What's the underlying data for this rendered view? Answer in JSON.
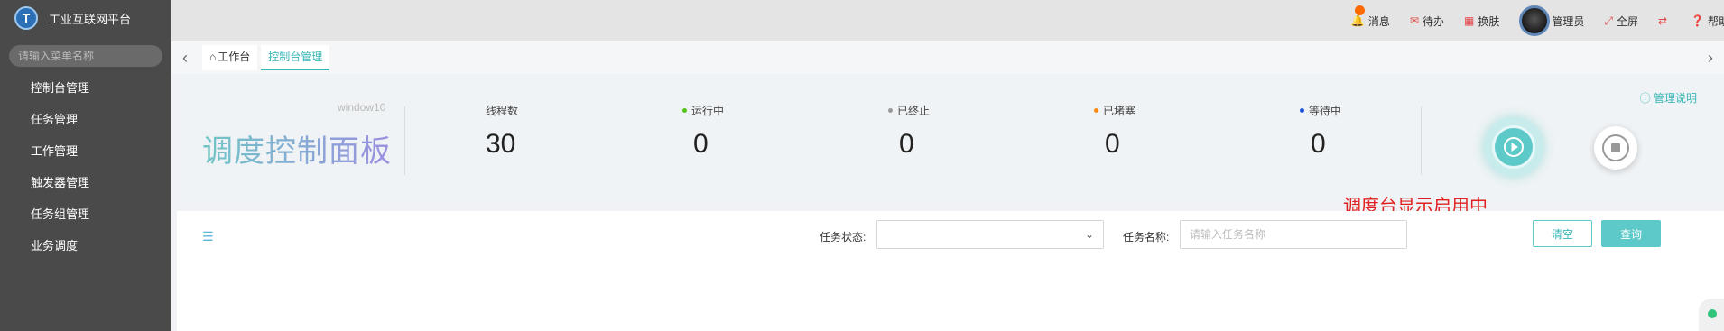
{
  "sidebar": {
    "logo_text": "T",
    "title": "工业互联网平台",
    "search_placeholder": "请输入菜单名称",
    "items": [
      {
        "label": "控制台管理"
      },
      {
        "label": "任务管理"
      },
      {
        "label": "工作管理"
      },
      {
        "label": "触发器管理"
      },
      {
        "label": "任务组管理"
      },
      {
        "label": "业务调度"
      }
    ]
  },
  "topbar": {
    "messages": "消息",
    "todo": "待办",
    "skin": "换肤",
    "user": "管理员",
    "fullscreen": "全屏",
    "help": "帮助"
  },
  "tabs": {
    "home": "工作台",
    "active": "控制台管理"
  },
  "dashboard": {
    "window_label": "window10",
    "title": "调度控制面板",
    "help_link": "管理说明",
    "stats": [
      {
        "label": "线程数",
        "value": "30",
        "color": ""
      },
      {
        "label": "运行中",
        "value": "0",
        "color": "#52c41a"
      },
      {
        "label": "已终止",
        "value": "0",
        "color": "#999999"
      },
      {
        "label": "已堵塞",
        "value": "0",
        "color": "#fa8c16"
      },
      {
        "label": "等待中",
        "value": "0",
        "color": "#1a56db"
      }
    ],
    "annotation": "调度台显示启用中"
  },
  "filters": {
    "status_label": "任务状态:",
    "name_label": "任务名称:",
    "name_placeholder": "请输入任务名称",
    "clear_label": "清空",
    "query_label": "查询"
  }
}
